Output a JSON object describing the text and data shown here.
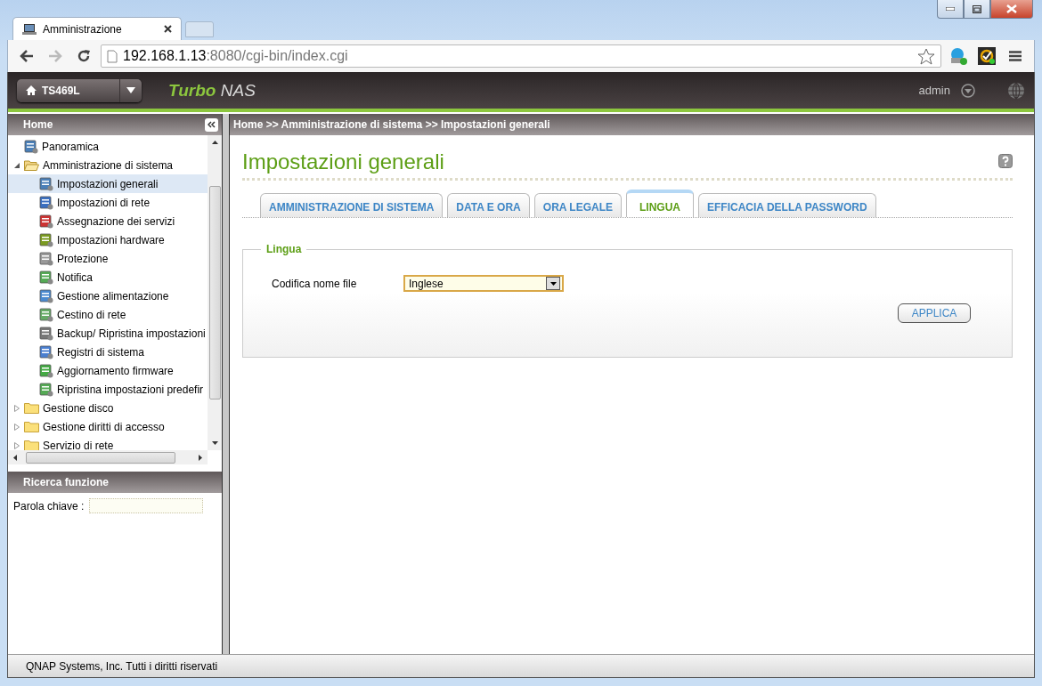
{
  "browser": {
    "tab": {
      "title": "Amministrazione"
    },
    "url": {
      "host": "192.168.1.13",
      "rest": ":8080/cgi-bin/index.cgi"
    }
  },
  "header": {
    "device": "TS469L",
    "brand": "**Turbo** NAS",
    "user": "admin"
  },
  "sidebar": {
    "title": "Home",
    "tree": [
      {
        "label": "Panoramica",
        "kind": "page",
        "selected": false
      },
      {
        "label": "Amministrazione di sistema",
        "kind": "folder",
        "expanded": true,
        "selected": false,
        "children": [
          {
            "label": "Impostazioni generali",
            "kind": "page",
            "selected": true
          },
          {
            "label": "Impostazioni di rete",
            "kind": "page",
            "selected": false
          },
          {
            "label": "Assegnazione dei servizi",
            "kind": "page",
            "selected": false
          },
          {
            "label": "Impostazioni hardware",
            "kind": "page",
            "selected": false
          },
          {
            "label": "Protezione",
            "kind": "page",
            "selected": false
          },
          {
            "label": "Notifica",
            "kind": "page",
            "selected": false
          },
          {
            "label": "Gestione alimentazione",
            "kind": "page",
            "selected": false
          },
          {
            "label": "Cestino di rete",
            "kind": "page",
            "selected": false
          },
          {
            "label": "Backup/ Ripristina impostazioni",
            "kind": "page",
            "selected": false
          },
          {
            "label": "Registri di sistema",
            "kind": "page",
            "selected": false
          },
          {
            "label": "Aggiornamento firmware",
            "kind": "page",
            "selected": false
          },
          {
            "label": "Ripristina impostazioni predefir",
            "kind": "page",
            "selected": false
          }
        ]
      },
      {
        "label": "Gestione disco",
        "kind": "folder",
        "expanded": false,
        "selected": false
      },
      {
        "label": "Gestione diritti di accesso",
        "kind": "folder",
        "expanded": false,
        "selected": false
      },
      {
        "label": "Servizio di rete",
        "kind": "folder",
        "expanded": false,
        "selected": false
      }
    ],
    "search": {
      "title": "Ricerca funzione",
      "label": "Parola chiave :"
    }
  },
  "breadcrumb": "Home >> Amministrazione di sistema >> Impostazioni generali",
  "main": {
    "title": "Impostazioni generali",
    "tabs": [
      {
        "label": "AMMINISTRAZIONE DI SISTEMA",
        "selected": false
      },
      {
        "label": "DATA E ORA",
        "selected": false
      },
      {
        "label": "ORA LEGALE",
        "selected": false
      },
      {
        "label": "LINGUA",
        "selected": true
      },
      {
        "label": "EFFICACIA DELLA PASSWORD",
        "selected": false
      }
    ],
    "group": {
      "legend": "Lingua",
      "field_label": "Codifica nome file",
      "value": "Inglese",
      "button": "APPLICA"
    }
  },
  "footer": "QNAP Systems, Inc. Tutti i diritti riservati"
}
